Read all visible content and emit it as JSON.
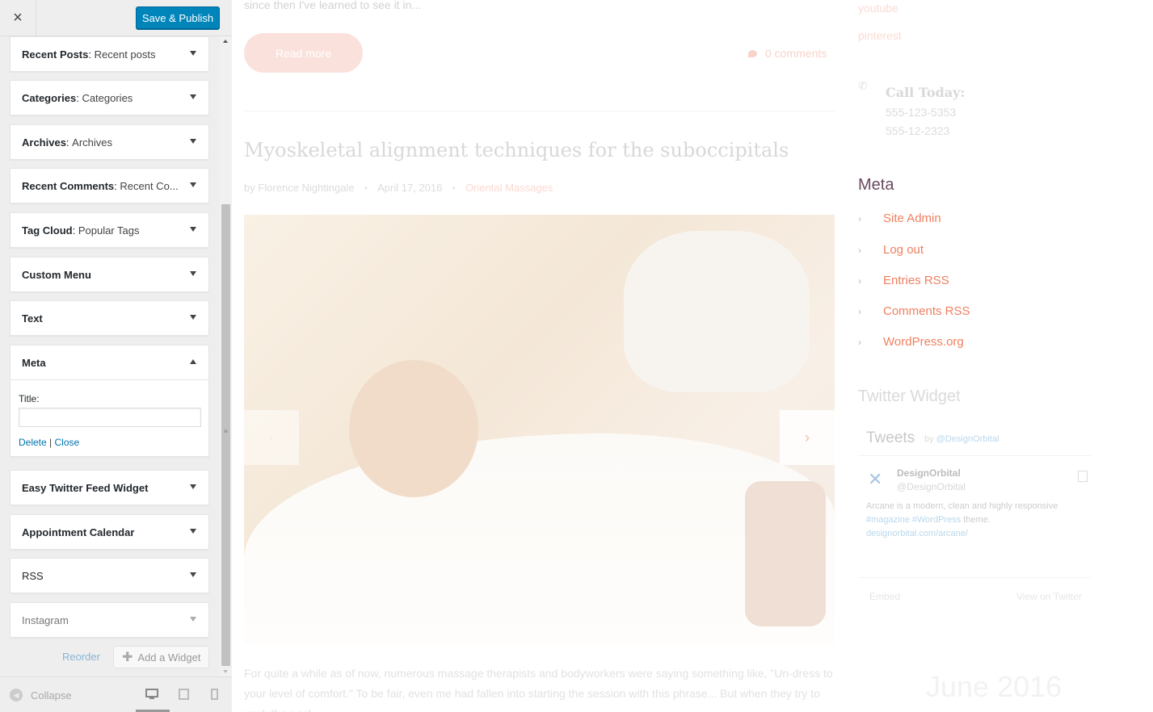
{
  "topbar": {
    "close": "×",
    "publish_label": "Save & Publish"
  },
  "widgets": [
    {
      "name": "Recent Posts",
      "sub": "Recent posts"
    },
    {
      "name": "Categories",
      "sub": "Categories"
    },
    {
      "name": "Archives",
      "sub": "Archives"
    },
    {
      "name": "Recent Comments",
      "sub": "Recent Co..."
    },
    {
      "name": "Tag Cloud",
      "sub": "Popular Tags"
    },
    {
      "name": "Custom Menu",
      "sub": ""
    },
    {
      "name": "Text",
      "sub": ""
    },
    {
      "name": "Meta",
      "sub": ""
    },
    {
      "name": "Easy Twitter Feed Widget",
      "sub": ""
    },
    {
      "name": "Appointment Calendar",
      "sub": ""
    },
    {
      "name": "RSS",
      "sub": ""
    },
    {
      "name": "Instagram",
      "sub": ""
    }
  ],
  "meta_form": {
    "title_label": "Title:",
    "title_value": "",
    "delete_label": "Delete",
    "sep": "|",
    "close_label": "Close"
  },
  "footer": {
    "reorder": "Reorder",
    "add_widget": "Add a Widget",
    "collapse": "Collapse"
  },
  "preview": {
    "excerpt_top": "since then I've learned to see it in...",
    "read_more": "Read more",
    "comments": "0 comments",
    "post_title": "Myoskeletal alignment techniques for the suboccipitals",
    "author": "by Florence Nightingale",
    "date": "April 17, 2016",
    "category": "Oriental Massages",
    "body": "For quite a while as of now, numerous massage therapists and bodyworkers were saying something like, \"Un-dress to your level of comfort.\" To be fair, even me had fallen into starting the session with this phrase... But when they try to work the neck"
  },
  "right": {
    "youtube": "youtube",
    "pinterest": "pinterest",
    "call_title": "Call Today:",
    "phone1": "555-123-5353",
    "phone2": "555-12-2323",
    "meta_heading": "Meta",
    "meta_links": [
      "Site Admin",
      "Log out",
      "Entries RSS",
      "Comments RSS",
      "WordPress.org"
    ],
    "twitter_heading": "Twitter Widget",
    "tweets_title": "Tweets",
    "tweets_by": "by",
    "tweets_handle": "@DesignOrbital",
    "tweet_name": "DesignOrbital",
    "tweet_handle": "@DesignOrbital",
    "tweet_text_1": "Arcane is a modern, clean and highly responsive",
    "tweet_tags": "#magazine #WordPress",
    "tweet_text_2": "theme.",
    "tweet_link": "designorbital.com/arcane/",
    "embed": "Embed",
    "view_on_twitter": "View on Twitter",
    "calendar": "June 2016"
  },
  "colors": {
    "publish": "#0085ba",
    "link": "#0073aa",
    "accent": "#f07f5f"
  }
}
